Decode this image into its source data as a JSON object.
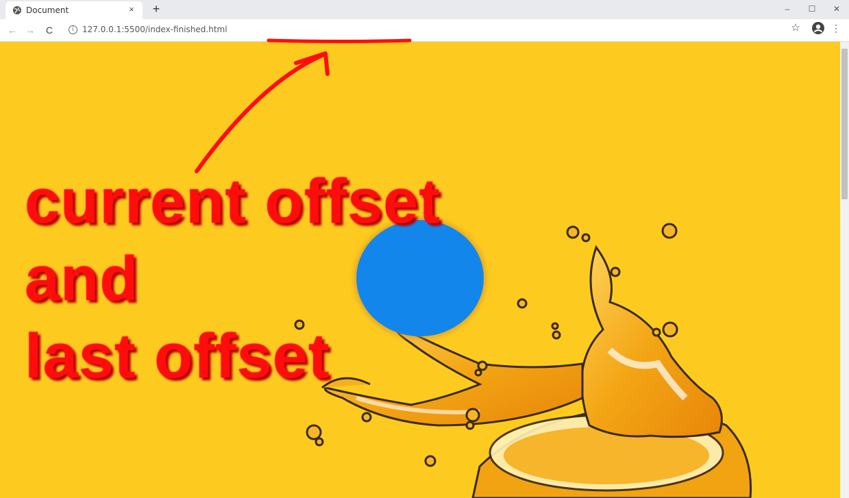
{
  "browser": {
    "tab_title": "Document",
    "tab_close": "×",
    "new_tab": "+",
    "url": "127.0.0.1:5500/index-finished.html",
    "nav": {
      "back": "←",
      "forward": "→",
      "reload": "C"
    },
    "window": {
      "minimize": "–",
      "maximize": "☐",
      "close": "✕"
    },
    "star": "☆",
    "menu": "⋮",
    "info": "i"
  },
  "annotation": {
    "lines": [
      "current offset",
      "and",
      "last offset"
    ],
    "color": "#ff0d0d"
  },
  "page": {
    "background_color": "#fdcb20",
    "ball_color": "#1386ec"
  }
}
